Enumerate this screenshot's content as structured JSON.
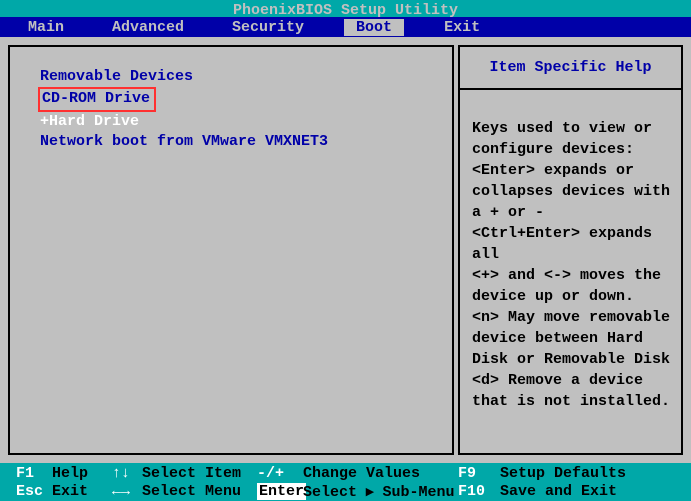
{
  "title": "PhoenixBIOS Setup Utility",
  "menu": {
    "items": [
      "Main",
      "Advanced",
      "Security",
      "Boot",
      "Exit"
    ],
    "active_index": 3
  },
  "boot": {
    "items": [
      {
        "label": " Removable Devices",
        "selected": false,
        "highlighted": false
      },
      {
        "label": " CD-ROM Drive",
        "selected": false,
        "highlighted": true
      },
      {
        "label": "+Hard Drive",
        "selected": true,
        "highlighted": false
      },
      {
        "label": " Network boot from VMware VMXNET3",
        "selected": false,
        "highlighted": false
      }
    ]
  },
  "help": {
    "title": "Item Specific Help",
    "body": "Keys used to view or configure devices:\n<Enter> expands or collapses devices with a + or -\n<Ctrl+Enter> expands all\n<+> and <-> moves the device up or down.\n<n> May move removable device between Hard Disk or Removable Disk\n<d> Remove a device that is not installed."
  },
  "footer": {
    "row1": {
      "k1": "F1",
      "d1": "Help",
      "k2": "↑↓",
      "d2": "Select Item",
      "k3": "-/+",
      "d3": "Change Values",
      "k4": "F9",
      "d4": "Setup Defaults"
    },
    "row2": {
      "k1": "Esc",
      "d1": "Exit",
      "k2": "←→",
      "d2": "Select Menu",
      "k3": "Enter",
      "d3": "Select ▸ Sub-Menu",
      "k4": "F10",
      "d4": "Save and Exit"
    }
  }
}
